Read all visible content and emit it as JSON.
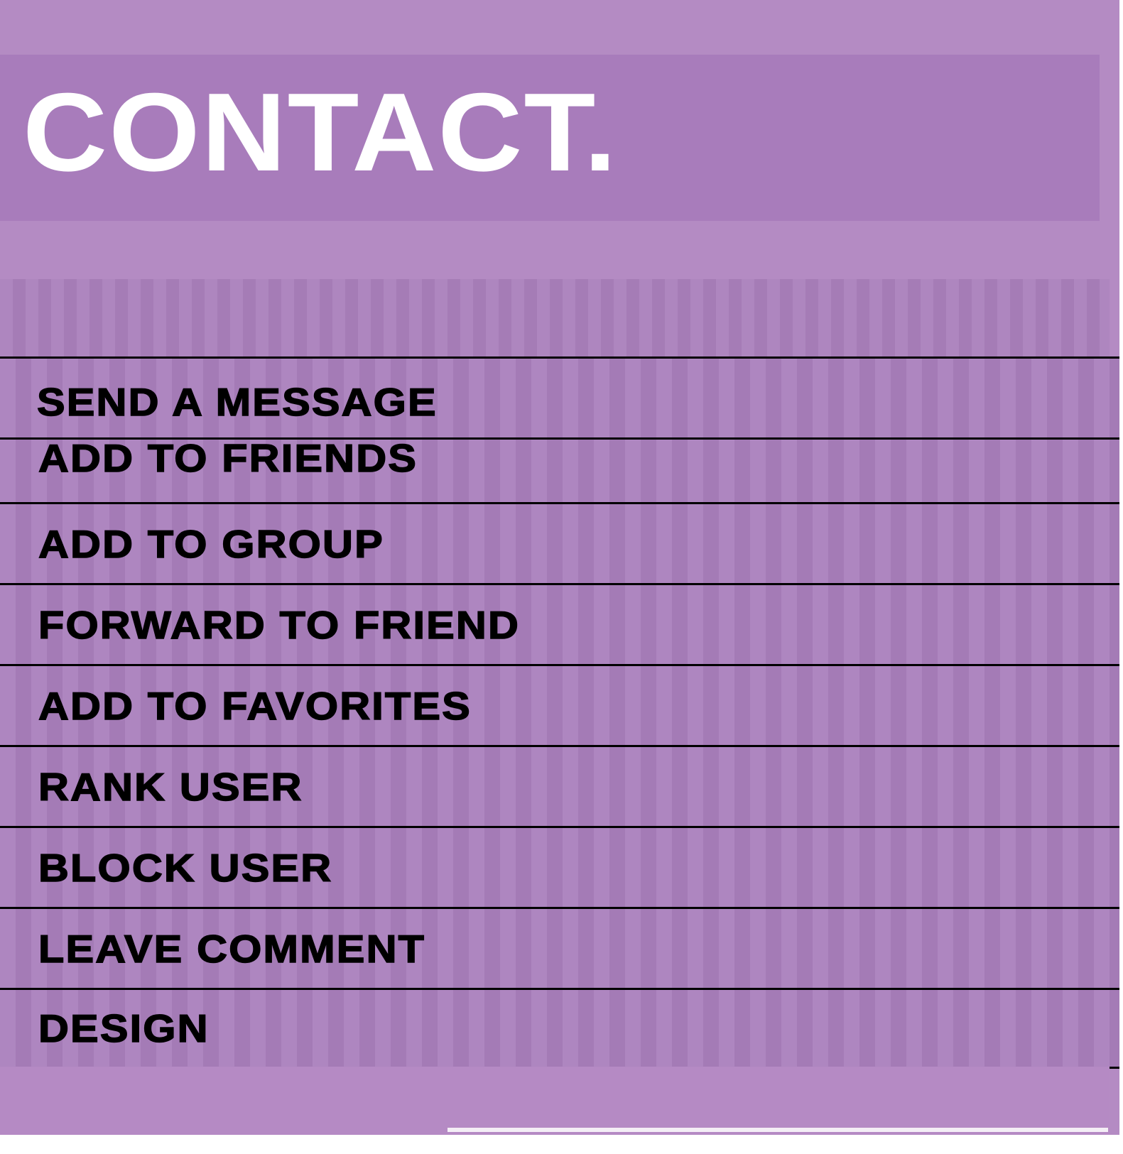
{
  "header": {
    "title": "CONTACT."
  },
  "menu": {
    "items": [
      {
        "label": "SEND A MESSAGE"
      },
      {
        "label": "ADD TO FRIENDS"
      },
      {
        "label": "ADD TO GROUP"
      },
      {
        "label": "FORWARD TO FRIEND"
      },
      {
        "label": "ADD TO FAVORITES"
      },
      {
        "label": "RANK USER"
      },
      {
        "label": "BLOCK USER"
      },
      {
        "label": "LEAVE COMMENT"
      },
      {
        "label": "DESIGN"
      }
    ]
  },
  "colors": {
    "panel_background": "#b48bc3",
    "header_band": "#a87cbb",
    "menu_row": "#aa7fbd",
    "title_text": "#ffffff",
    "menu_text": "#000000",
    "divider": "#000000"
  }
}
